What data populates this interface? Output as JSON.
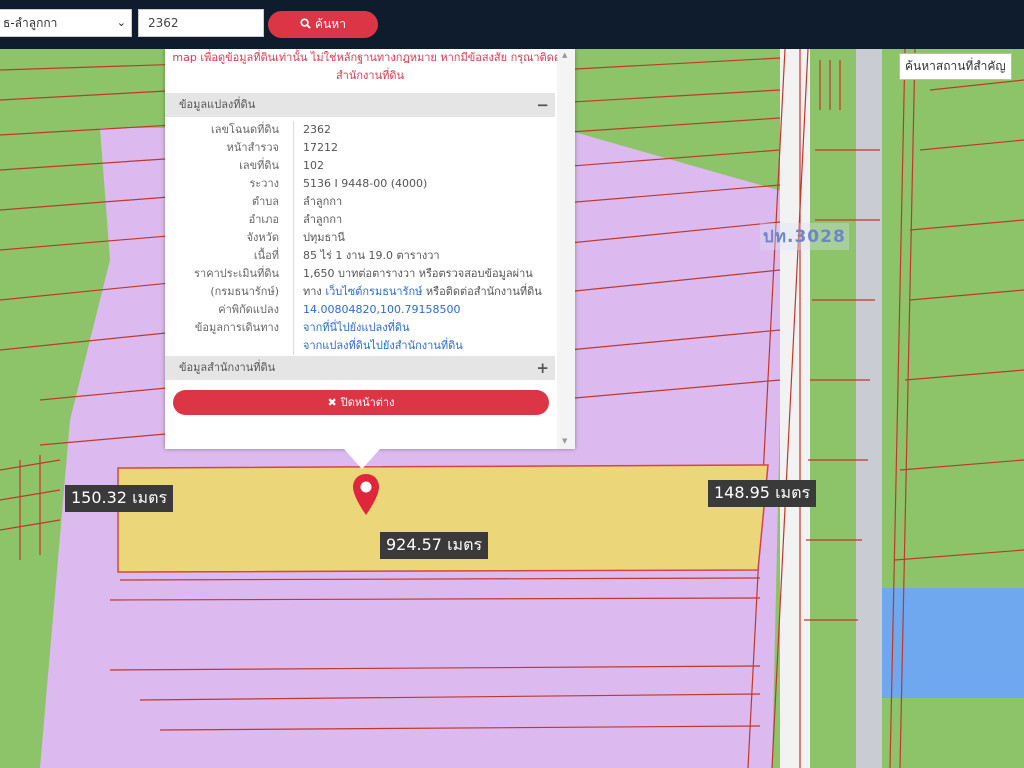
{
  "search": {
    "location_value": "ธ-ลำลูกกา",
    "deed_value": "2362",
    "search_label": "ค้นหา"
  },
  "landmark_button": "ค้นหาสถานที่สำคัญ",
  "popup": {
    "notice": "map เพื่อดูข้อมูลที่ดินเท่านั้น ไม่ใช่หลักฐานทางกฎหมาย หากมีข้อสงสัย กรุณาติดต่อสำนักงานที่ดิน",
    "section_parcel": "ข้อมูลแปลงที่ดิน",
    "section_office": "ข้อมูลสำนักงานที่ดิน",
    "collapse_symbol": "−",
    "expand_symbol": "+",
    "rows": [
      {
        "label": "เลขโฉนดที่ดิน",
        "value": "2362"
      },
      {
        "label": "หน้าสำรวจ",
        "value": "17212"
      },
      {
        "label": "เลขที่ดิน",
        "value": "102"
      },
      {
        "label": "ระวาง",
        "value": "5136 I 9448-00 (4000)"
      },
      {
        "label": "ตำบล",
        "value": "ลำลูกกา"
      },
      {
        "label": "อำเภอ",
        "value": "ลำลูกกา"
      },
      {
        "label": "จังหวัด",
        "value": "ปทุมธานี"
      },
      {
        "label": "เนื้อที่",
        "value": "85 ไร่ 1 งาน 19.0 ตารางวา"
      },
      {
        "label": "ราคาประเมินที่ดิน",
        "value": "1,650 บาทต่อตารางวา หรือตรวจสอบข้อมูลผ่าน"
      },
      {
        "label": "(กรมธนารักษ์)",
        "value_a": "ทาง",
        "value_link": "เว็บไซต์กรมธนารักษ์",
        "value_b": "หรือติดต่อสำนักงานที่ดิน"
      },
      {
        "label": "ค่าพิกัดแปลง",
        "value": "14.00804820,100.79158500"
      },
      {
        "label": "ข้อมูลการเดินทาง",
        "value": "จากที่นี่ไปยังแปลงที่ดิน"
      },
      {
        "label": "",
        "value": "จากแปลงที่ดินไปยังสำนักงานที่ดิน"
      }
    ],
    "close_label": "ปิดหน้าต่าง"
  },
  "measurements": {
    "left": "150.32 เมตร",
    "right": "148.95 เมตร",
    "bottom": "924.57 เมตร"
  },
  "road_label": "ปท.3028",
  "colors": {
    "topbar": "#0f1c2e",
    "accent_red": "#dc3545",
    "agri_green": "#8dc46a",
    "zone_purple": "#dcb9ee",
    "parcel_yellow": "#ecd67a",
    "boundary_red": "#c0392b",
    "water_blue": "#6fa8ee"
  }
}
